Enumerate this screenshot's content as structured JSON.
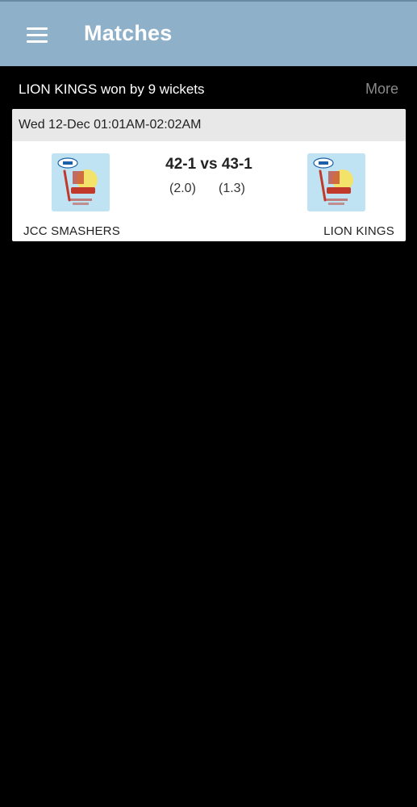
{
  "app_bar": {
    "title": "Matches",
    "menu_icon": "menu-icon",
    "color": "#8fb0c9"
  },
  "result": {
    "text": "LION KINGS won by 9 wickets",
    "more_label": "More"
  },
  "match": {
    "datetime": "Wed 12-Dec 01:01AM-02:02AM",
    "score_line": "42-1 vs 43-1",
    "team1": {
      "name": "JCC SMASHERS",
      "overs": "(2.0)",
      "logo_icon": "tournament-logo-icon"
    },
    "team2": {
      "name": "LION KINGS",
      "overs": "(1.3)",
      "logo_icon": "tournament-logo-icon"
    }
  }
}
